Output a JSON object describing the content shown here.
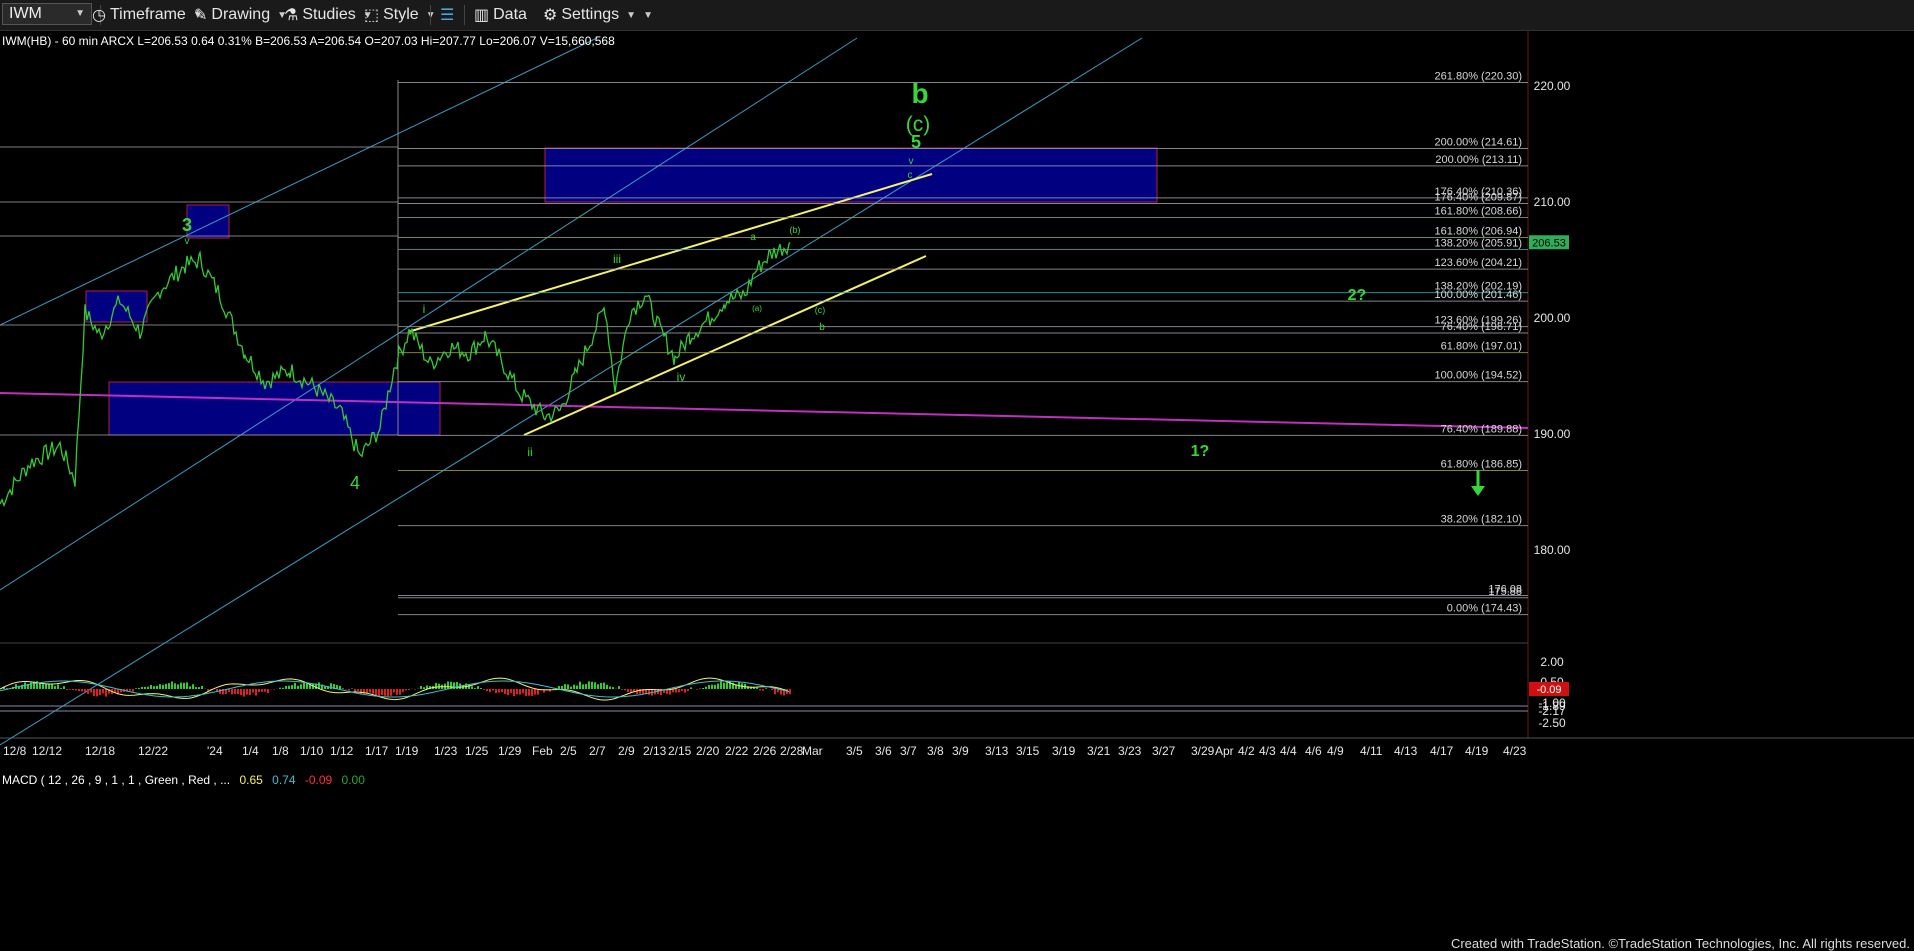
{
  "toolbar": {
    "symbol": "IWM",
    "timeframe": "Timeframe",
    "drawing": "Drawing",
    "studies": "Studies",
    "style": "Style",
    "data": "Data",
    "settings": "Settings"
  },
  "footer": "Created with TradeStation. ©TradeStation Technologies, Inc. All rights reserved.",
  "chart_data": [
    {
      "type": "line",
      "header": "IWM(HB) - 60 min  ARCX  L=206.53  0.64  0.31%  B=206.53  A=206.54  O=207.03  Hi=207.77  Lo=206.07  V=15,660,568",
      "last_price": "206.53",
      "y_ticks": [
        "220.00",
        "210.00",
        "200.00",
        "190.00",
        "180.00"
      ],
      "ylim": [
        172,
        224
      ],
      "x_ticks": [
        "12/8",
        "12/12",
        "12/18",
        "12/22",
        "'24",
        "1/4",
        "1/8",
        "1/10",
        "1/12",
        "1/17",
        "1/19",
        "1/23",
        "1/25",
        "1/29",
        "Feb",
        "2/5",
        "2/7",
        "2/9",
        "2/13",
        "2/15",
        "2/20",
        "2/22",
        "2/26",
        "2/28",
        "Mar",
        "3/5",
        "3/6",
        "3/7",
        "3/8",
        "3/9",
        "3/13",
        "3/15",
        "3/19",
        "3/21",
        "3/23",
        "3/27",
        "3/29",
        "Apr",
        "4/2",
        "4/3",
        "4/4",
        "4/6",
        "4/9",
        "4/11",
        "4/13",
        "4/17",
        "4/19",
        "4/23"
      ],
      "price_keypoints": [
        [
          0,
          184.0
        ],
        [
          30,
          187.5
        ],
        [
          60,
          189.0
        ],
        [
          75,
          186.0
        ],
        [
          85,
          200.5
        ],
        [
          100,
          198.5
        ],
        [
          120,
          201.5
        ],
        [
          140,
          198.8
        ],
        [
          160,
          202.5
        ],
        [
          185,
          204.5
        ],
        [
          200,
          205.0
        ],
        [
          220,
          202.0
        ],
        [
          245,
          197.0
        ],
        [
          265,
          194.5
        ],
        [
          290,
          195.5
        ],
        [
          315,
          194.0
        ],
        [
          340,
          192.0
        ],
        [
          360,
          188.0
        ],
        [
          380,
          190.5
        ],
        [
          395,
          196.0
        ],
        [
          410,
          199.0
        ],
        [
          430,
          196.0
        ],
        [
          450,
          197.5
        ],
        [
          470,
          197.0
        ],
        [
          485,
          198.5
        ],
        [
          500,
          196.5
        ],
        [
          520,
          193.5
        ],
        [
          545,
          191.5
        ],
        [
          560,
          192.0
        ],
        [
          575,
          195.0
        ],
        [
          590,
          198.0
        ],
        [
          605,
          201.0
        ],
        [
          615,
          194.0
        ],
        [
          630,
          200.5
        ],
        [
          645,
          202.0
        ],
        [
          660,
          199.0
        ],
        [
          675,
          196.5
        ],
        [
          690,
          198.5
        ],
        [
          710,
          200.0
        ],
        [
          725,
          201.5
        ],
        [
          745,
          202.0
        ],
        [
          755,
          204.0
        ],
        [
          770,
          205.5
        ],
        [
          785,
          206.2
        ],
        [
          790,
          206.53
        ]
      ],
      "fib_levels": [
        {
          "pct": "261.80%",
          "price": 220.3
        },
        {
          "pct": "200.00%",
          "price": 214.61
        },
        {
          "pct": "200.00%",
          "price": 213.11
        },
        {
          "pct": "176.40%",
          "price": 210.36
        },
        {
          "pct": "176.40%",
          "price": 209.87
        },
        {
          "pct": "161.80%",
          "price": 208.66
        },
        {
          "pct": "161.80%",
          "price": 206.94
        },
        {
          "pct": "138.20%",
          "price": 205.91
        },
        {
          "pct": "123.60%",
          "price": 204.21
        },
        {
          "pct": "138.20%",
          "price": 202.19
        },
        {
          "pct": "100.00%",
          "price": 201.46
        },
        {
          "pct": "123.60%",
          "price": 199.26
        },
        {
          "pct": "76.40%",
          "price": 198.71
        },
        {
          "pct": "61.80%",
          "price": 197.01
        },
        {
          "pct": "100.00%",
          "price": 194.52
        },
        {
          "pct": "76.40%",
          "price": 189.88
        },
        {
          "pct": "61.80%",
          "price": 186.85
        },
        {
          "pct": "38.20%",
          "price": 182.1
        },
        {
          "pct": "",
          "price": 176.08
        },
        {
          "pct": "",
          "price": 175.88
        },
        {
          "pct": "0.00%",
          "price": 174.43
        }
      ],
      "wave_labels": [
        "b",
        "(c)",
        "5",
        "3",
        "4",
        "i",
        "ii",
        "iii",
        "iv",
        "v",
        "v",
        "a",
        "b",
        "c",
        "(a)",
        "(b)",
        "(c)",
        "2?",
        "1?"
      ],
      "colors": {
        "price": "#35c935",
        "channel": "#3b9bc2",
        "wedge": "#f4f26a",
        "magenta": "#c030c0",
        "box": "#000080",
        "box_border": "#b02040",
        "label": "#39d639"
      }
    },
    {
      "type": "line",
      "header": "MACD ( 12 , 26 , 9 , 1 , 1 , Green , Red , ...  0.65  0.74  -0.09  0.00",
      "values": [
        "0.65",
        "0.74",
        "-0.09",
        "0.00"
      ],
      "y_ticks": [
        "2.00",
        "0.50",
        "-1.00",
        "-1.89",
        "-2.17",
        "-2.50"
      ],
      "ylim": [
        -3,
        3
      ],
      "current": "-0.09"
    }
  ]
}
